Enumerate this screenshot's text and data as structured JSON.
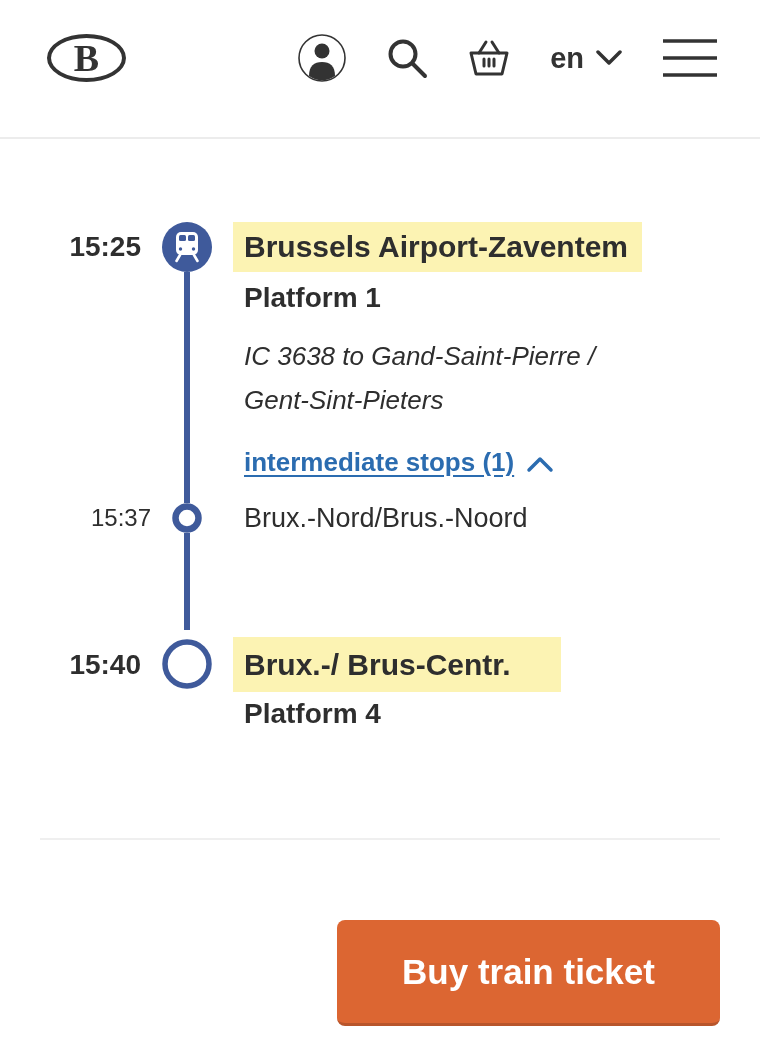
{
  "header": {
    "logo": "B",
    "language": "en"
  },
  "stops": [
    {
      "kind": "origin",
      "time": "15:25",
      "station": "Brussels Airport-Zaventem",
      "platform": "Platform 1",
      "train": "IC 3638 to Gand-Saint-Pierre / Gent-Sint-Pieters",
      "stops_link": "intermediate stops (1)",
      "expanded": true
    },
    {
      "kind": "intermediate",
      "time": "15:37",
      "station": "Brux.-Nord/Brus.-Noord"
    },
    {
      "kind": "destination",
      "time": "15:40",
      "station": "Brux.-/ Brus-Centr.",
      "platform": "Platform 4"
    }
  ],
  "buy_button": "Buy train ticket"
}
